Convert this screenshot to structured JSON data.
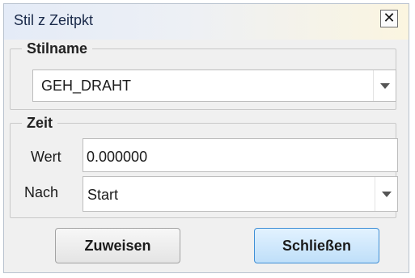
{
  "dialog": {
    "title": "Stil z Zeitpkt",
    "close_label": "✕"
  },
  "stil_group": {
    "legend": "Stilname",
    "selected": "GEH_DRAHT"
  },
  "zeit_group": {
    "legend": "Zeit",
    "wert_label": "Wert",
    "wert_value": "0.000000",
    "nach_label": "Nach",
    "nach_selected": "Start"
  },
  "buttons": {
    "assign": "Zuweisen",
    "close": "Schließen"
  },
  "icons": {
    "dropdown": "chevron-down-icon",
    "close": "close-icon"
  }
}
